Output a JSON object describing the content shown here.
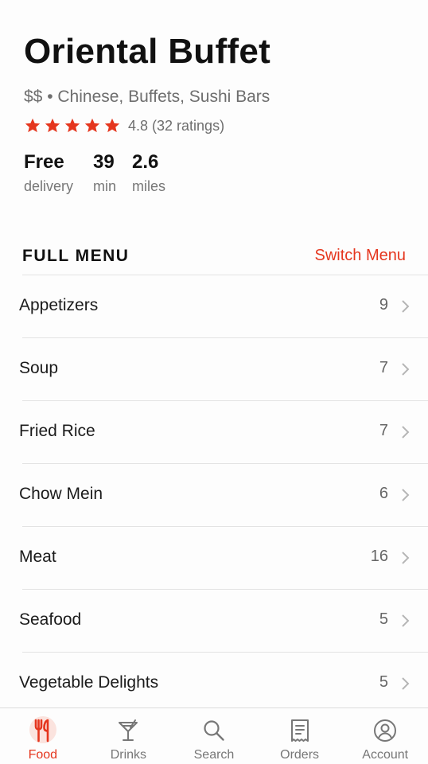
{
  "store": {
    "name": "Oriental Buffet",
    "meta": "$$ • Chinese, Buffets, Sushi Bars",
    "rating_text": "4.8 (32 ratings)",
    "star_count": 5,
    "accent_color": "#e5361e"
  },
  "stats": [
    {
      "value": "Free",
      "label": "delivery"
    },
    {
      "value": "39",
      "label": "min"
    },
    {
      "value": "2.6",
      "label": "miles"
    }
  ],
  "menu": {
    "title": "FULL MENU",
    "switch_label": "Switch Menu",
    "items": [
      {
        "label": "Appetizers",
        "count": "9"
      },
      {
        "label": "Soup",
        "count": "7"
      },
      {
        "label": "Fried Rice",
        "count": "7"
      },
      {
        "label": "Chow Mein",
        "count": "6"
      },
      {
        "label": "Meat",
        "count": "16"
      },
      {
        "label": "Seafood",
        "count": "5"
      },
      {
        "label": "Vegetable Delights",
        "count": "5"
      }
    ]
  },
  "tabs": [
    {
      "label": "Food",
      "icon": "fork-knife-icon",
      "active": true
    },
    {
      "label": "Drinks",
      "icon": "cocktail-icon",
      "active": false
    },
    {
      "label": "Search",
      "icon": "search-icon",
      "active": false
    },
    {
      "label": "Orders",
      "icon": "receipt-icon",
      "active": false
    },
    {
      "label": "Account",
      "icon": "account-icon",
      "active": false
    }
  ]
}
